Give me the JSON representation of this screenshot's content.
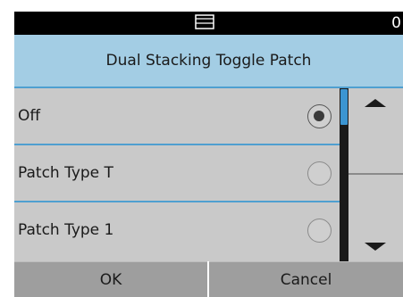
{
  "status_bar": {
    "icon": "output-tray-icon",
    "counter": "0"
  },
  "title": "Dual Stacking Toggle Patch",
  "options": [
    {
      "label": "Off",
      "selected": true
    },
    {
      "label": "Patch Type T",
      "selected": false
    },
    {
      "label": "Patch Type 1",
      "selected": false
    }
  ],
  "scroll": {
    "up_icon": "triangle-up-icon",
    "down_icon": "triangle-down-icon"
  },
  "buttons": {
    "ok_label": "OK",
    "cancel_label": "Cancel"
  },
  "colors": {
    "accent": "#4f9fd0",
    "title_bg": "#a3cde4",
    "list_bg": "#c9c9c9",
    "button_bg": "#9e9e9e"
  }
}
